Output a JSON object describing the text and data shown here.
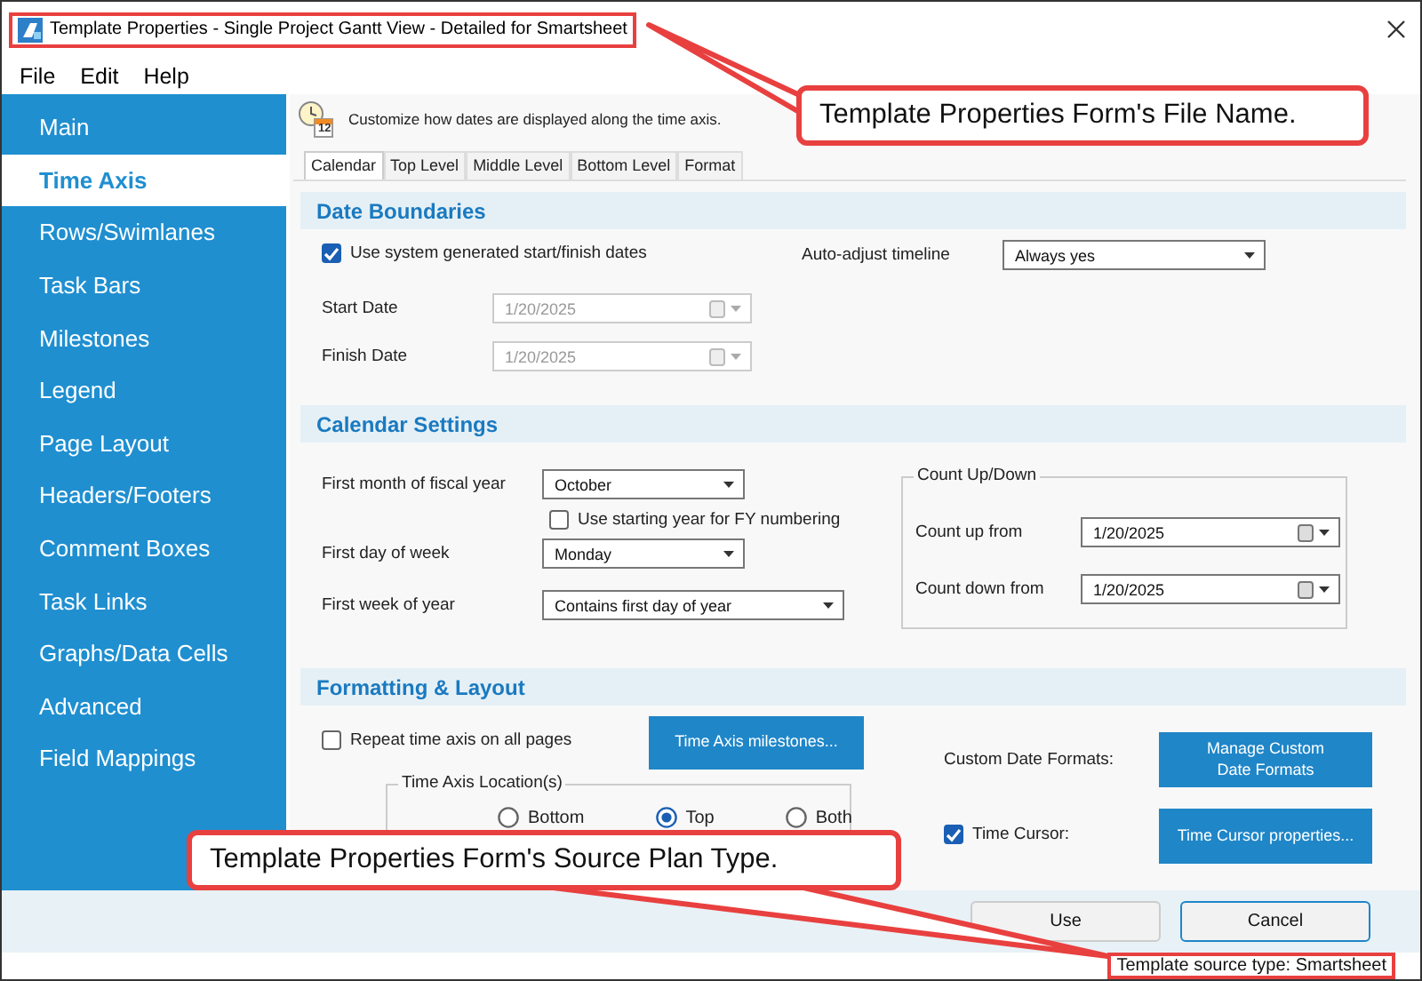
{
  "window": {
    "title": "Template Properties - Single Project Gantt View - Detailed for Smartsheet"
  },
  "menu": [
    "File",
    "Edit",
    "Help"
  ],
  "sidebar": {
    "items": [
      {
        "label": "Main",
        "selected": false
      },
      {
        "label": "Time Axis",
        "selected": true
      },
      {
        "label": "Rows/Swimlanes",
        "selected": false
      },
      {
        "label": "Task Bars",
        "selected": false
      },
      {
        "label": "Milestones",
        "selected": false
      },
      {
        "label": "Legend",
        "selected": false
      },
      {
        "label": "Page Layout",
        "selected": false
      },
      {
        "label": "Headers/Footers",
        "selected": false
      },
      {
        "label": "Comment Boxes",
        "selected": false
      },
      {
        "label": "Task Links",
        "selected": false
      },
      {
        "label": "Graphs/Data Cells",
        "selected": false
      },
      {
        "label": "Advanced",
        "selected": false
      },
      {
        "label": "Field Mappings",
        "selected": false
      }
    ]
  },
  "header": {
    "icon_badge": "12",
    "description": "Customize how dates are displayed along the time axis."
  },
  "tabs": [
    {
      "label": "Calendar",
      "selected": true
    },
    {
      "label": "Top Level",
      "selected": false
    },
    {
      "label": "Middle Level",
      "selected": false
    },
    {
      "label": "Bottom Level",
      "selected": false
    },
    {
      "label": "Format",
      "selected": false
    }
  ],
  "date_boundaries": {
    "title": "Date Boundaries",
    "use_system_dates": {
      "label": "Use system generated start/finish dates",
      "checked": true
    },
    "auto_adjust": {
      "label": "Auto-adjust timeline",
      "value": "Always yes"
    },
    "start_date": {
      "label": "Start Date",
      "value": "1/20/2025",
      "disabled": true
    },
    "finish_date": {
      "label": "Finish Date",
      "value": "1/20/2025",
      "disabled": true
    }
  },
  "calendar_settings": {
    "title": "Calendar Settings",
    "first_month": {
      "label": "First month of fiscal year",
      "value": "October"
    },
    "fy_numbering": {
      "label": "Use starting year for FY numbering",
      "checked": false
    },
    "first_day": {
      "label": "First day of week",
      "value": "Monday"
    },
    "first_week": {
      "label": "First week of year",
      "value": "Contains first day of year"
    },
    "count_group": {
      "title": "Count Up/Down",
      "count_up": {
        "label": "Count up from",
        "value": "1/20/2025"
      },
      "count_down": {
        "label": "Count down from",
        "value": "1/20/2025"
      }
    }
  },
  "formatting": {
    "title": "Formatting & Layout",
    "repeat_axis": {
      "label": "Repeat time axis on all pages",
      "checked": false
    },
    "milestones_button": "Time Axis milestones...",
    "custom_formats_label": "Custom Date Formats:",
    "manage_button": "Manage Custom Date Formats",
    "location": {
      "title": "Time Axis Location(s)",
      "options": [
        {
          "label": "Bottom",
          "selected": false
        },
        {
          "label": "Top",
          "selected": true
        },
        {
          "label": "Both",
          "selected": false
        }
      ]
    },
    "time_cursor": {
      "label": "Time Cursor:",
      "checked": true
    },
    "cursor_button": "Time Cursor properties..."
  },
  "footer": {
    "buttons": [
      "Use",
      "Cancel"
    ],
    "source_type": "Template source type: Smartsheet"
  },
  "callouts": [
    {
      "text": "Template Properties Form's File Name."
    },
    {
      "text": "Template Properties Form's Source Plan Type."
    }
  ]
}
